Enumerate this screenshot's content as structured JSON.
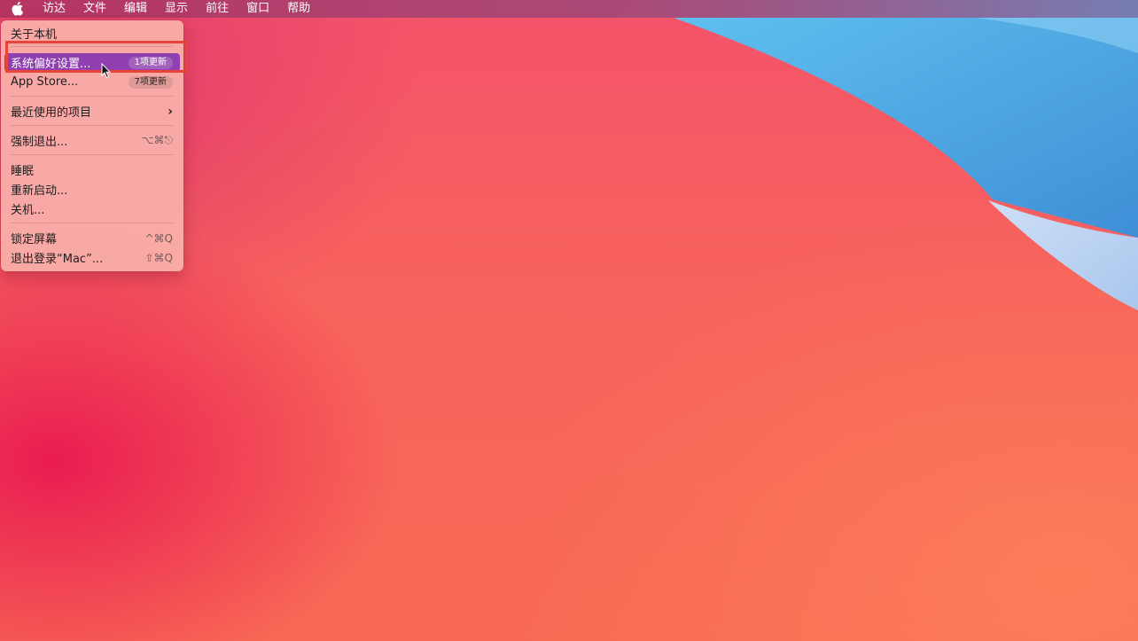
{
  "menubar": {
    "apple_icon": "apple-logo-icon",
    "items": [
      "访达",
      "文件",
      "编辑",
      "显示",
      "前往",
      "窗口",
      "帮助"
    ]
  },
  "apple_menu": {
    "about": "关于本机",
    "system_prefs": {
      "label": "系统偏好设置...",
      "badge": "1项更新"
    },
    "app_store": {
      "label": "App Store...",
      "badge": "7项更新"
    },
    "recent_items": "最近使用的项目",
    "force_quit": {
      "label": "强制退出...",
      "shortcut": "⌥⌘⎋"
    },
    "sleep": "睡眠",
    "restart": "重新启动...",
    "shutdown": "关机...",
    "lock_screen": {
      "label": "锁定屏幕",
      "shortcut": "^⌘Q"
    },
    "logout": {
      "label": "退出登录“Mac”...",
      "shortcut": "⇧⌘Q"
    }
  },
  "colors": {
    "selection": "#8f3fb0",
    "highlight_border": "#e8443a"
  }
}
